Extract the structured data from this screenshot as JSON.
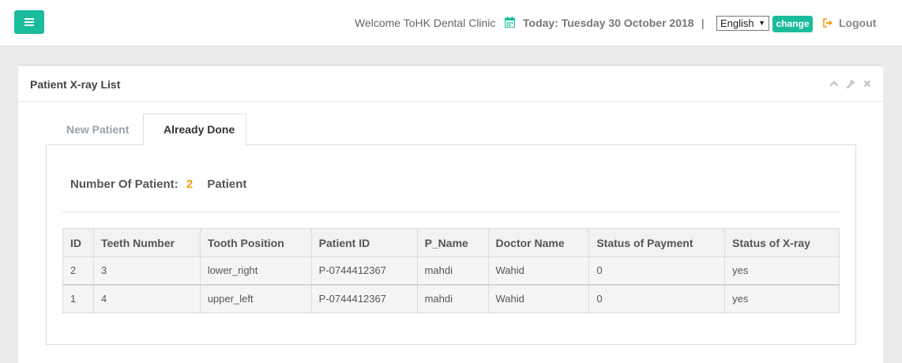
{
  "header": {
    "welcome": "Welcome ToHK Dental Clinic",
    "today": "Today:  Tuesday 30 October 2018",
    "separator": "|",
    "language_selected": "English",
    "change_label": "change",
    "logout_label": "Logout",
    "accent_color": "#1abc9c",
    "icons": [
      "menu-icon",
      "calendar-icon",
      "logout-icon"
    ]
  },
  "panel": {
    "title": "Patient X-ray List",
    "tools": [
      "chevron-up-icon",
      "wrench-icon",
      "close-icon"
    ]
  },
  "tabs": [
    {
      "label": "New Patient",
      "active": false
    },
    {
      "label": "Already Done",
      "active": true
    }
  ],
  "summary": {
    "label": "Number Of Patient:",
    "count": "2",
    "suffix": "Patient",
    "count_color": "#f39c12"
  },
  "table": {
    "columns": [
      "ID",
      "Teeth Number",
      "Tooth Position",
      "Patient ID",
      "P_Name",
      "Doctor Name",
      "Status of Payment",
      "Status of X-ray"
    ],
    "rows": [
      [
        "2",
        "3",
        "lower_right",
        "P-0744412367",
        "mahdi",
        "Wahid",
        "0",
        "yes"
      ],
      [
        "1",
        "4",
        "upper_left",
        "P-0744412367",
        "mahdi",
        "Wahid",
        "0",
        "yes"
      ]
    ]
  }
}
